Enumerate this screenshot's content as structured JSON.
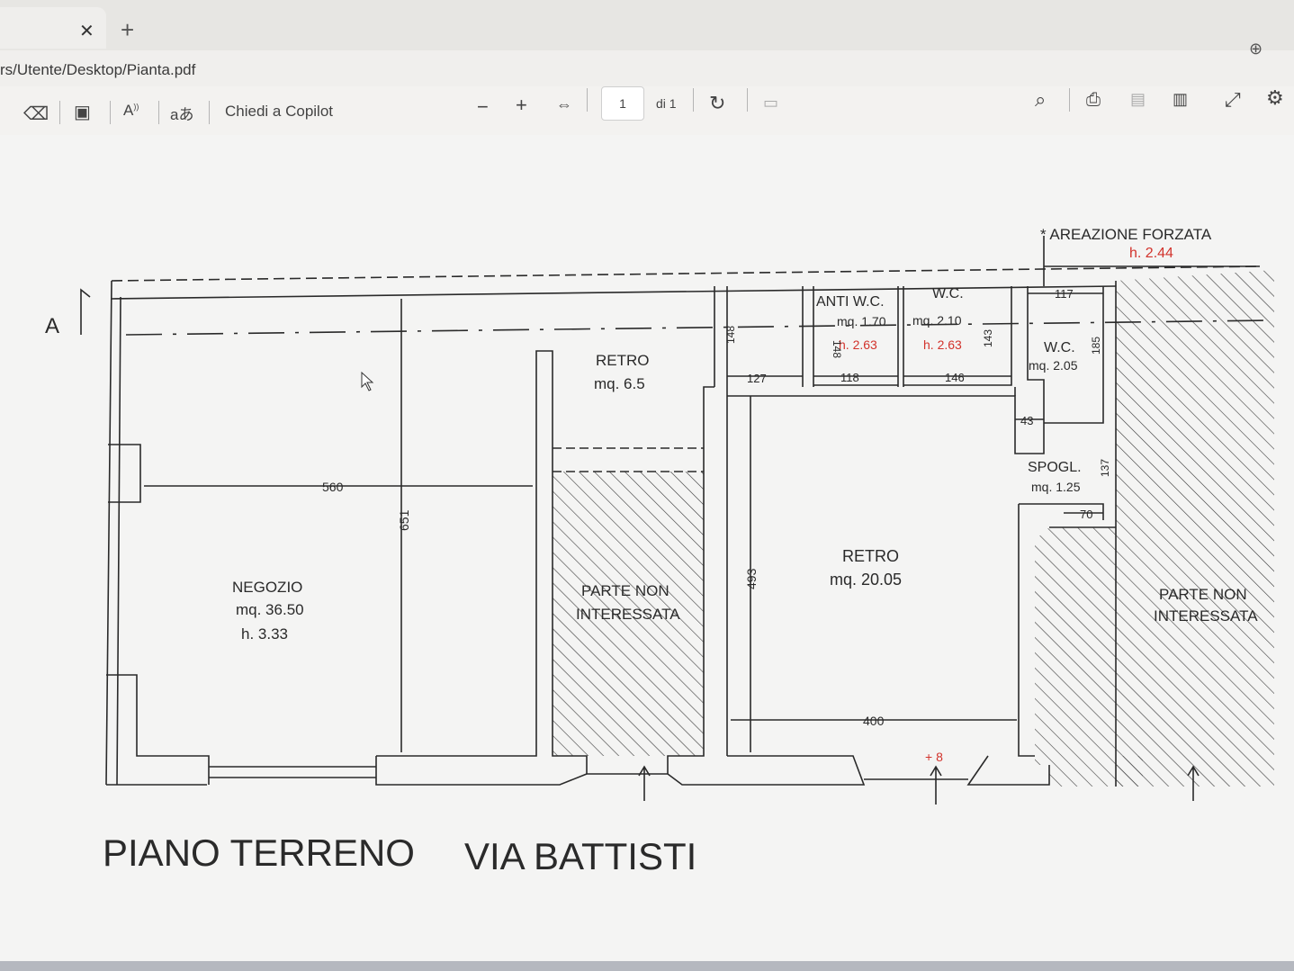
{
  "tab": {
    "close_icon": "close-icon",
    "new_tab_icon": "plus-icon"
  },
  "address": {
    "path": "rs/Utente/Desktop/Pianta.pdf"
  },
  "toolbar": {
    "copilot_label": "Chiedi a Copilot",
    "page_number": "1",
    "page_total": "di 1",
    "icons": [
      "eraser-icon",
      "text-box-icon",
      "read-aloud-icon",
      "translate-icon",
      "zoom-out-icon",
      "zoom-in-icon",
      "fit-page-icon",
      "rotate-icon",
      "page-view-icon",
      "search-icon",
      "print-icon",
      "save-icon",
      "save-as-icon",
      "fullscreen-icon",
      "settings-icon"
    ]
  },
  "plan": {
    "areazione": "* AREAZIONE FORZATA",
    "areazione_h": "h. 2.44",
    "section_marker": "A",
    "negozio": {
      "name": "NEGOZIO",
      "area": "mq. 36.50",
      "height": "h. 3.33"
    },
    "retro_small": {
      "name": "RETRO",
      "area": "mq. 6.5"
    },
    "retro_big": {
      "name": "RETRO",
      "area": "mq. 20.05"
    },
    "anti_wc": {
      "name": "ANTI W.C.",
      "area": "mq. 1.70",
      "height": "h. 2.63"
    },
    "wc1": {
      "name": "W.C.",
      "area": "mq. 2.10",
      "height": "h. 2.63"
    },
    "wc2": {
      "name": "W.C.",
      "area": "mq. 2.05"
    },
    "spogl": {
      "name": "SPOGL.",
      "area": "mq. 1.25"
    },
    "parte_non_1": "PARTE NON",
    "parte_non_2": "INTERESSATA",
    "dims": {
      "d560": "560",
      "d651": "651",
      "d493": "493",
      "d400": "400",
      "d148a": "148",
      "d148b": "148",
      "d143": "143",
      "d127": "127",
      "d118": "118",
      "d146": "146",
      "d117": "117",
      "d185": "185",
      "d43": "43",
      "d137": "137",
      "d70": "70",
      "plus8": "+ 8"
    },
    "title_left": "PIANO TERRENO",
    "title_right": "VIA BATTISTI"
  },
  "colors": {
    "ink": "#2a2a2a",
    "red": "#d2332c",
    "paper": "#f4f4f3"
  }
}
